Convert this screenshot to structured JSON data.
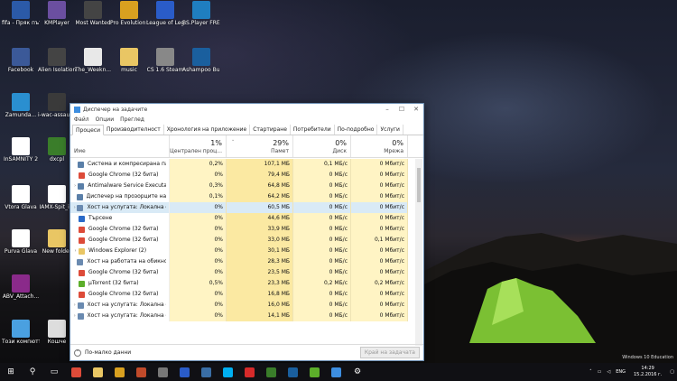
{
  "desktop": {
    "icons": [
      {
        "label": "fifa - Пряк път",
        "icon": "fifa-shortcut-icon",
        "color": "#2b5aa8"
      },
      {
        "label": "KMPlayer",
        "icon": "kmplayer-icon",
        "color": "#6b4fa0"
      },
      {
        "label": "Most Wanted",
        "icon": "most-wanted-icon",
        "color": "#444444"
      },
      {
        "label": "Pro Evolution Soccer 2016",
        "icon": "pes-icon",
        "color": "#d8a020"
      },
      {
        "label": "League of Legends",
        "icon": "league-icon",
        "color": "#2a5cc8"
      },
      {
        "label": "BS.Player FREE",
        "icon": "bsplayer-icon",
        "color": "#1f7ec0"
      },
      {
        "label": "Facebook",
        "icon": "facebook-icon",
        "color": "#3b5998"
      },
      {
        "label": "Alien Isolation",
        "icon": "alien-icon",
        "color": "#444444"
      },
      {
        "label": "The_Weekn...",
        "icon": "audio-file-icon",
        "color": "#e8e8e8"
      },
      {
        "label": "music",
        "icon": "folder-icon",
        "color": "#e9c664"
      },
      {
        "label": "CS 1.6 Steam",
        "icon": "cs-steam-icon",
        "color": "#888888"
      },
      {
        "label": "Ashampoo Burning S...",
        "icon": "ashampoo-icon",
        "color": "#1a5f9e"
      },
      {
        "label": "Zamunda...",
        "icon": "zamunda-icon",
        "color": "#2a8fd0"
      },
      {
        "label": "i-wac-assaul...",
        "icon": "file-icon",
        "color": "#3a3a3a"
      },
      {
        "label": "InSAMNITY 2",
        "icon": "document-icon",
        "color": "#ffffff"
      },
      {
        "label": "dxcpl",
        "icon": "dxcpl-icon",
        "color": "#3a7d2a"
      },
      {
        "label": "Vtora Glava",
        "icon": "pdf-edge-icon",
        "color": "#ffffff"
      },
      {
        "label": "IAMX-Spit_i...",
        "icon": "document-icon",
        "color": "#ffffff"
      },
      {
        "label": "Purva Glava",
        "icon": "pdf-edge-icon",
        "color": "#ffffff"
      },
      {
        "label": "New folder",
        "icon": "folder-icon",
        "color": "#e9c664"
      },
      {
        "label": "ABV_Attach...",
        "icon": "winrar-icon",
        "color": "#8a2a8a"
      },
      {
        "label": "Този компютър",
        "icon": "computer-icon",
        "color": "#4aa0e0"
      },
      {
        "label": "Кошче",
        "icon": "recycle-bin-icon",
        "color": "#dddddd"
      }
    ],
    "watermark": "Windows 10 Education"
  },
  "taskmgr": {
    "title": "Диспечер на задачите",
    "menu": [
      "Файл",
      "Опции",
      "Преглед"
    ],
    "tabs": [
      "Процеси",
      "Производителност",
      "Хронология на приложение",
      "Стартиране",
      "Потребители",
      "По-подробно",
      "Услуги"
    ],
    "columns": {
      "name": "Име",
      "cpu": {
        "pct": "1%",
        "label": "Централен проц..."
      },
      "mem": {
        "pct": "29%",
        "label": "Памет"
      },
      "disk": {
        "pct": "0%",
        "label": "Диск"
      },
      "net": {
        "pct": "0%",
        "label": "Мрежа"
      }
    },
    "rows": [
      {
        "name": "Система и компресирана памет",
        "cpu": "0,2%",
        "mem": "107,1 МБ",
        "disk": "0,1 МБ/с",
        "net": "0 Мбит/с",
        "expand": false,
        "icon": "system-icon",
        "color": "#5a7fa8"
      },
      {
        "name": "Google Chrome (32 бита)",
        "cpu": "0%",
        "mem": "79,4 МБ",
        "disk": "0 МБ/с",
        "net": "0 Мбит/с",
        "expand": false,
        "icon": "chrome-icon",
        "color": "#dd4b39"
      },
      {
        "name": "Antimalware Service Executable",
        "cpu": "0,3%",
        "mem": "64,8 МБ",
        "disk": "0 МБ/с",
        "net": "0 Мбит/с",
        "expand": true,
        "icon": "service-icon",
        "color": "#5a7fa8"
      },
      {
        "name": "Диспечер на прозорците на работния плот",
        "cpu": "0,1%",
        "mem": "64,2 МБ",
        "disk": "0 МБ/с",
        "net": "0 Мбит/с",
        "expand": false,
        "icon": "dwm-icon",
        "color": "#5a7fa8"
      },
      {
        "name": "Хост на услугата: Локална система",
        "cpu": "0%",
        "mem": "60,5 МБ",
        "disk": "0 МБ/с",
        "net": "0 Мбит/с",
        "expand": true,
        "icon": "service-host-icon",
        "color": "#6a8ab0"
      },
      {
        "name": "Търсене",
        "cpu": "0%",
        "mem": "44,6 МБ",
        "disk": "0 МБ/с",
        "net": "0 Мбит/с",
        "expand": false,
        "icon": "search-process-icon",
        "color": "#2a6ac8"
      },
      {
        "name": "Google Chrome (32 бита)",
        "cpu": "0%",
        "mem": "33,9 МБ",
        "disk": "0 МБ/с",
        "net": "0 Мбит/с",
        "expand": false,
        "icon": "chrome-icon",
        "color": "#dd4b39"
      },
      {
        "name": "Google Chrome (32 бита)",
        "cpu": "0%",
        "mem": "33,0 МБ",
        "disk": "0 МБ/с",
        "net": "0,1 Мбит/с",
        "expand": false,
        "icon": "chrome-icon",
        "color": "#dd4b39"
      },
      {
        "name": "Windows Explorer (2)",
        "cpu": "0%",
        "mem": "30,1 МБ",
        "disk": "0 МБ/с",
        "net": "0 Мбит/с",
        "expand": true,
        "icon": "explorer-icon",
        "color": "#e9c664"
      },
      {
        "name": "Хост на работата на обикновения...",
        "cpu": "0%",
        "mem": "28,3 МБ",
        "disk": "0 МБ/с",
        "net": "0 Мбит/с",
        "expand": false,
        "icon": "service-host-icon",
        "color": "#6a8ab0"
      },
      {
        "name": "Google Chrome (32 бита)",
        "cpu": "0%",
        "mem": "23,5 МБ",
        "disk": "0 МБ/с",
        "net": "0 Мбит/с",
        "expand": false,
        "icon": "chrome-icon",
        "color": "#dd4b39"
      },
      {
        "name": "µTorrent (32 бита)",
        "cpu": "0,5%",
        "mem": "23,3 МБ",
        "disk": "0,2 МБ/с",
        "net": "0,2 Мбит/с",
        "expand": false,
        "icon": "utorrent-icon",
        "color": "#5cae2a"
      },
      {
        "name": "Google Chrome (32 бита)",
        "cpu": "0%",
        "mem": "16,8 МБ",
        "disk": "0 МБ/с",
        "net": "0 Мбит/с",
        "expand": false,
        "icon": "chrome-icon",
        "color": "#dd4b39"
      },
      {
        "name": "Хост на услугата: Локална систе...",
        "cpu": "0%",
        "mem": "16,0 МБ",
        "disk": "0 МБ/с",
        "net": "0 Мбит/с",
        "expand": true,
        "icon": "service-host-icon",
        "color": "#6a8ab0"
      },
      {
        "name": "Хост на услугата: Локална систе...",
        "cpu": "0%",
        "mem": "14,1 МБ",
        "disk": "0 МБ/с",
        "net": "0 Мбит/с",
        "expand": true,
        "icon": "service-host-icon",
        "color": "#6a8ab0"
      }
    ],
    "footer": {
      "less": "По-малко данни",
      "end_task": "Край на задачата"
    }
  },
  "taskbar": {
    "pinned": [
      {
        "icon": "windows-start-icon",
        "color": "#ffffff"
      },
      {
        "icon": "search-icon",
        "color": "#ffffff"
      },
      {
        "icon": "task-view-icon",
        "color": "#ffffff"
      },
      {
        "icon": "chrome-icon",
        "color": "#dd4b39"
      },
      {
        "icon": "file-explorer-icon",
        "color": "#e9c664"
      },
      {
        "icon": "pes-icon",
        "color": "#d8a020"
      },
      {
        "icon": "alien-icon",
        "color": "#c04a2a"
      },
      {
        "icon": "most-wanted-icon",
        "color": "#777777"
      },
      {
        "icon": "league-icon",
        "color": "#2a5cc8"
      },
      {
        "icon": "steam-icon",
        "color": "#3a6ea5"
      },
      {
        "icon": "skype-icon",
        "color": "#00aff0"
      },
      {
        "icon": "opera-icon",
        "color": "#d62a2a"
      },
      {
        "icon": "dxcpl-icon",
        "color": "#3a7d2a"
      },
      {
        "icon": "ashampoo-icon",
        "color": "#1a5f9e"
      },
      {
        "icon": "utorrent-icon",
        "color": "#5cae2a"
      },
      {
        "icon": "task-manager-icon",
        "color": "#3d8ee0"
      },
      {
        "icon": "settings-gear-icon",
        "color": "#ffffff"
      }
    ],
    "language": "ENG",
    "time": "14:29",
    "date": "15.2.2016 г."
  }
}
